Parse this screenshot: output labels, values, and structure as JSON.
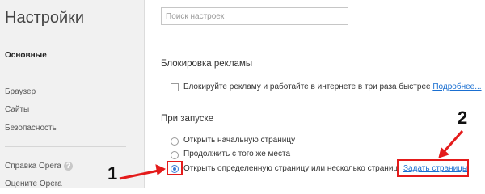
{
  "sidebar": {
    "title": "Настройки",
    "items": [
      {
        "label": "Основные"
      },
      {
        "label": "Браузер"
      },
      {
        "label": "Сайты"
      },
      {
        "label": "Безопасность"
      },
      {
        "label": "Справка Opera"
      },
      {
        "label": "Оцените Opera"
      }
    ]
  },
  "search": {
    "placeholder": "Поиск настроек"
  },
  "adblock": {
    "title": "Блокировка рекламы",
    "checkbox_label": "Блокируйте рекламу и работайте в интернете в три раза быстрее",
    "more_link": "Подробнее..."
  },
  "startup": {
    "title": "При запуске",
    "options": [
      {
        "label": "Открыть начальную страницу"
      },
      {
        "label": "Продолжить с того же места"
      },
      {
        "label": "Открыть определенную страницу или несколько страниц"
      }
    ],
    "set_pages_link": "Задать страницы"
  },
  "annotations": {
    "one": "1",
    "two": "2"
  },
  "colors": {
    "annotation": "#e41b1b",
    "link": "#1a6fd1",
    "accent": "#3a7bd5"
  },
  "icons": {
    "help": "question-circle-icon"
  }
}
